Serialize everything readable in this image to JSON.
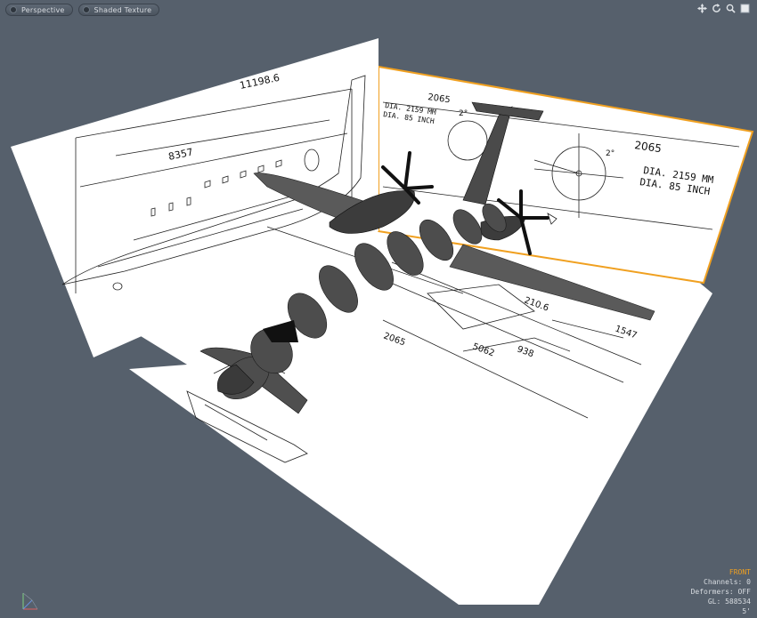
{
  "toolbar": {
    "view_mode": "Perspective",
    "shading_mode": "Shaded Texture"
  },
  "nav_icons": [
    "move-view-icon",
    "rotate-view-icon",
    "zoom-view-icon",
    "fit-view-icon"
  ],
  "hud": {
    "view_name": "FRONT",
    "channels": "Channels: 0",
    "deformers": "Deformers: OFF",
    "gl_count": "GL: 588534",
    "grid": "5'"
  },
  "blueprint_left": {
    "dim_top": "11198.6",
    "dim_mid": "8357"
  },
  "blueprint_right": {
    "dim_a": "2065",
    "dim_b": "2065",
    "dia_small_1": "DIA. 2159 MM",
    "dia_small_2": "DIA. 85 INCH",
    "dia_large_1": "DIA. 2159 MM",
    "dia_large_2": "DIA. 85 INCH",
    "angle_1": "2°",
    "angle_2": "2°"
  },
  "blueprint_floor": {
    "dim_1": "2065",
    "dim_2": "5062",
    "dim_3": "938",
    "dim_4": "1547",
    "dim_5": "210.6"
  },
  "colors": {
    "viewport_bg": "#56606c",
    "selection_outline": "#f0a020",
    "blueprint_paper": "#ffffff"
  }
}
